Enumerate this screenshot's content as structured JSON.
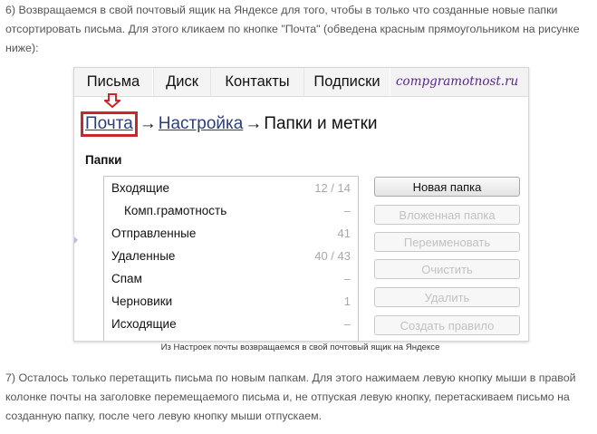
{
  "intro_text": "6) Возвращаемся в свой почтовый ящик на Яндексе для того, чтобы в только что созданные новые папки отсортировать письма. Для этого кликаем по кнопке \"Почта\" (обведена красным прямоугольником на рисунке ниже):",
  "screenshot": {
    "tabs": [
      "Письма",
      "Диск",
      "Контакты",
      "Подписки"
    ],
    "watermark": "compgramotnost.ru",
    "breadcrumb": {
      "first": "Почта",
      "arrow": "→",
      "second": "Настройка",
      "current": "Папки и метки"
    },
    "folders_title": "Папки",
    "folders": [
      {
        "name": "Входящие",
        "count": "12 / 14",
        "sub": false
      },
      {
        "name": "Комп.грамотность",
        "count": "–",
        "sub": true
      },
      {
        "name": "Отправленные",
        "count": "41",
        "sub": false
      },
      {
        "name": "Удаленные",
        "count": "40 / 43",
        "sub": false
      },
      {
        "name": "Спам",
        "count": "–",
        "sub": false
      },
      {
        "name": "Черновики",
        "count": "1",
        "sub": false
      },
      {
        "name": "Исходящие",
        "count": "–",
        "sub": false
      }
    ],
    "buttons": [
      {
        "label": "Новая папка",
        "enabled": true
      },
      {
        "label": "Вложенная папка",
        "enabled": false
      },
      {
        "label": "Переименовать",
        "enabled": false
      },
      {
        "label": "Очистить",
        "enabled": false
      },
      {
        "label": "Удалить",
        "enabled": false
      },
      {
        "label": "Создать правило",
        "enabled": false
      }
    ],
    "highlight_color": "#c8282c"
  },
  "caption": "Из Настроек почты возвращаемся в свой почтовый ящик на Яндексе",
  "step_text": "7) Осталось только перетащить письма по новым папкам. Для этого нажимаем левую кнопку мыши в правой колонке почты на заголовке перемещаемого письма и, не отпуская левую кнопку, перетаскиваем письмо на созданную папку, после чего левую кнопку мыши отпускаем."
}
